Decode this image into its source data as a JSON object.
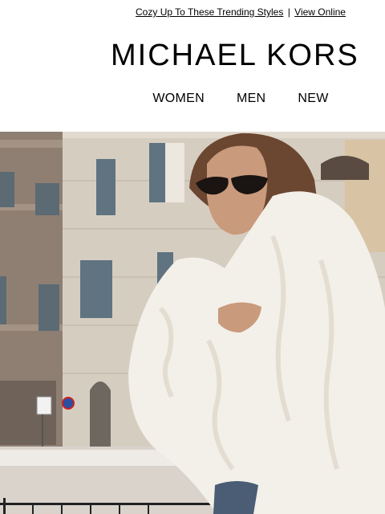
{
  "preheader": {
    "link_text": "Cozy Up To These Trending Styles",
    "separator": "|",
    "view_online": "View Online"
  },
  "brand": {
    "logo_text": "MICHAEL KORS"
  },
  "nav": {
    "items": [
      {
        "label": "WOMEN"
      },
      {
        "label": "MEN"
      },
      {
        "label": "NEW"
      }
    ]
  },
  "hero": {
    "icon": "hero-photo",
    "colors": {
      "building_left": "#8c7a6c",
      "building_mid": "#d4cbc0",
      "coat": "#f3efe9",
      "hair": "#6b4630",
      "shutters": "#5f7380"
    }
  }
}
